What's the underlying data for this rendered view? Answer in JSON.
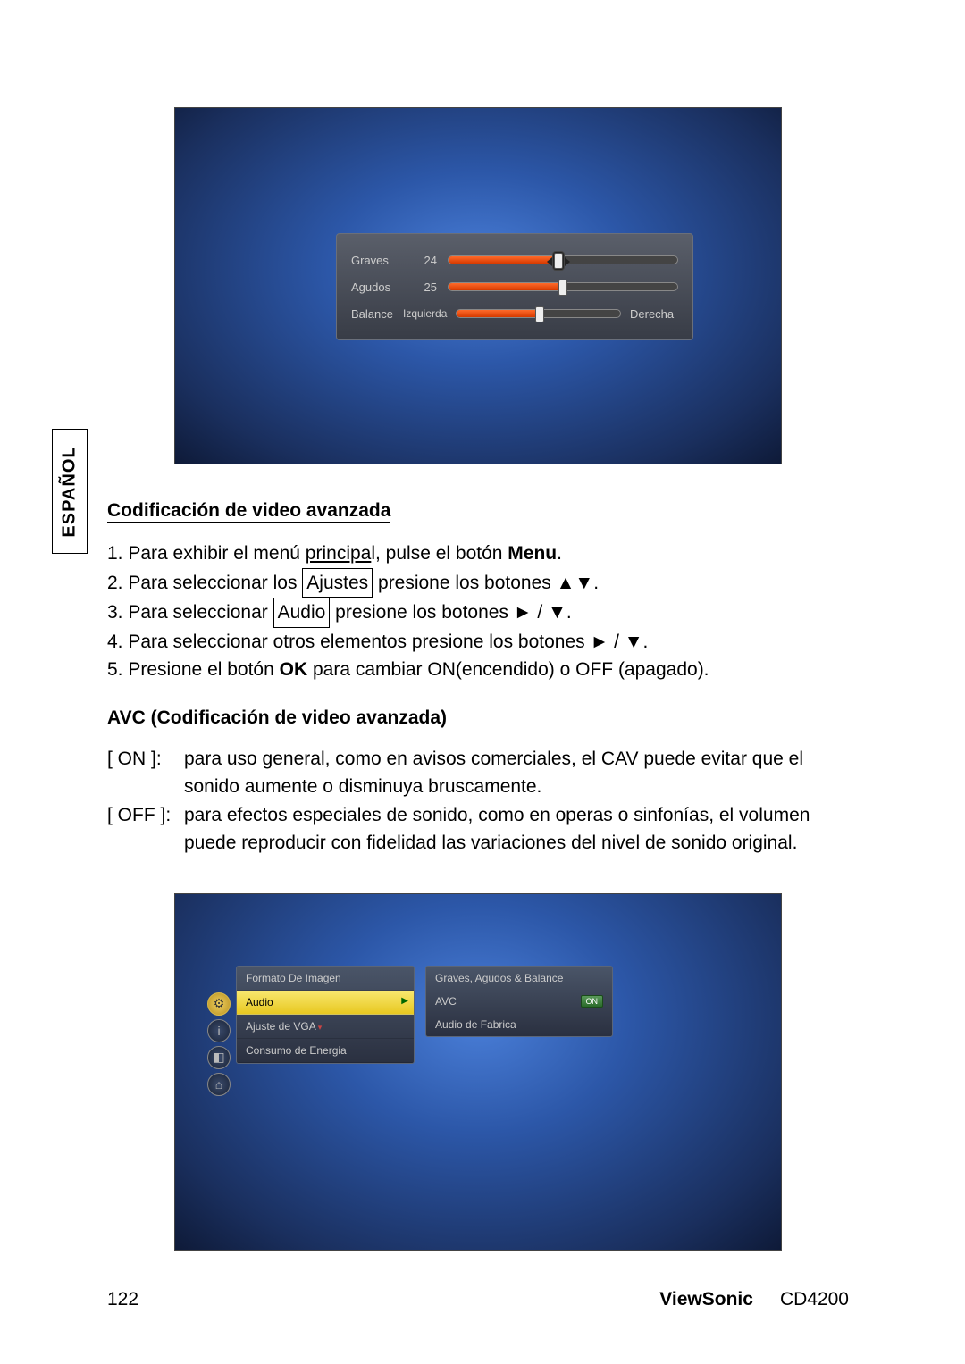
{
  "sideTab": "ESPAÑOL",
  "screenshot1": {
    "rows": [
      {
        "label": "Graves",
        "value": "24",
        "fillPct": 48,
        "thumbPct": 48,
        "active": true
      },
      {
        "label": "Agudos",
        "value": "25",
        "fillPct": 50,
        "thumbPct": 50,
        "active": false
      }
    ],
    "balance": {
      "label": "Balance",
      "leftLabel": "Izquierda",
      "rightLabel": "Derecha",
      "fillPct": 50,
      "thumbPct": 50
    }
  },
  "heading1": "Codificación de video avanzada",
  "instructions": {
    "line1_pre": "1. Para exhibir el menú ",
    "line1_u": "principa",
    "line1_post": "l, pulse el botón ",
    "line1_bold": "Menu",
    "line1_end": ".",
    "line2_pre": "2. Para seleccionar los ",
    "line2_box": "Ajustes",
    "line2_post": " presione los botones ▲▼.",
    "line3_pre": "3. Para seleccionar ",
    "line3_box": "Audio",
    "line3_post": " presione los botones ► / ▼.",
    "line4": "4. Para seleccionar otros elementos presione los botones ► / ▼.",
    "line5_pre": "5. Presione el botón ",
    "line5_bold": "OK",
    "line5_post": " para cambiar ON(encendido) o OFF (apagado)."
  },
  "heading2": "AVC (Codificación de video avanzada)",
  "descriptions": {
    "on": {
      "tag": "[ ON ]:",
      "text": "para uso general, como en avisos comerciales, el CAV puede evitar que el sonido aumente o disminuya bruscamente."
    },
    "off": {
      "tag": "[ OFF ]:",
      "text": "para efectos especiales de sonido, como en operas o sinfonías, el volumen puede reproducir con fidelidad las variaciones del nivel de sonido original."
    }
  },
  "screenshot2": {
    "leftMenu": {
      "items": [
        {
          "label": "Formato De Imagen",
          "highlight": false,
          "sub": false
        },
        {
          "label": "Audio",
          "highlight": true,
          "sub": false
        },
        {
          "label": "Ajuste de VGA",
          "highlight": false,
          "sub": true
        },
        {
          "label": "Consumo de Energia",
          "highlight": false,
          "sub": false
        }
      ]
    },
    "rightMenu": {
      "items": [
        {
          "label": "Graves, Agudos & Balance",
          "badge": ""
        },
        {
          "label": "AVC",
          "badge": "ON"
        },
        {
          "label": "Audio de Fabrica",
          "badge": ""
        }
      ]
    }
  },
  "footer": {
    "page": "122",
    "brand": "ViewSonic",
    "model": "CD4200"
  }
}
